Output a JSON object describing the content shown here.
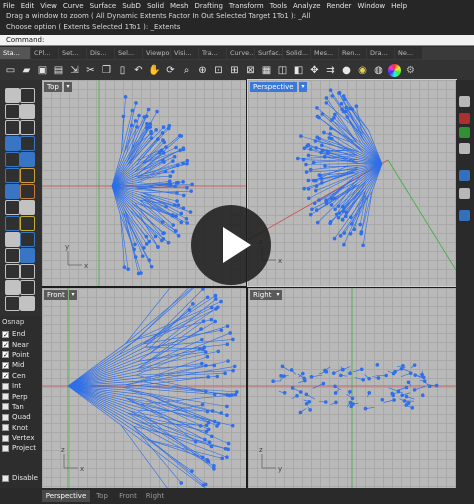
{
  "menu": [
    "File",
    "Edit",
    "View",
    "Curve",
    "Surface",
    "SubD",
    "Solid",
    "Mesh",
    "Drafting",
    "Transform",
    "Tools",
    "Analyze",
    "Render",
    "Window",
    "Help"
  ],
  "history": [
    "Drag a window to zoom ( All  Dynamic  Extents  Factor  In  Out  Selected  Target  1To1 ): _All",
    "Choose option ( Extents  Selected  1To1 ): _Extents"
  ],
  "command_prompt": "Command:",
  "toolbar_tabs": [
    "Sta...",
    "CPl...",
    "Set...",
    "Dis...",
    "Sel...",
    "Viewpo...",
    "Visi...",
    "Tra...",
    "Curve...",
    "Surfac...",
    "Solid...",
    "Mes...",
    "Ren...",
    "Dra...",
    "Ne..."
  ],
  "toolbar_icons": [
    "new-file-icon",
    "open-folder-icon",
    "save-icon",
    "print-icon",
    "import-icon",
    "cut-icon",
    "copy-icon",
    "paste-icon",
    "undo-icon",
    "pan-hand-icon",
    "rotate-view-icon",
    "zoom-icon",
    "zoom-window-icon",
    "zoom-extents-icon",
    "zoom-selected-icon",
    "zoom-all-icon",
    "four-views-icon",
    "set-cplane-icon",
    "cplane-icon",
    "move-icon",
    "copy-move-icon",
    "shade-icon",
    "render-icon",
    "materials-icon",
    "color-wheel-icon",
    "options-icon"
  ],
  "viewports": [
    {
      "label": "Top",
      "active": false
    },
    {
      "label": "Perspective",
      "active": true
    },
    {
      "label": "Front",
      "active": false
    },
    {
      "label": "Right",
      "active": false
    }
  ],
  "osnap": {
    "title": "Osnap",
    "items": [
      {
        "label": "End",
        "checked": true
      },
      {
        "label": "Near",
        "checked": true
      },
      {
        "label": "Point",
        "checked": true
      },
      {
        "label": "Mid",
        "checked": true
      },
      {
        "label": "Cen",
        "checked": true
      },
      {
        "label": "Int",
        "checked": false
      },
      {
        "label": "Perp",
        "checked": false
      },
      {
        "label": "Tan",
        "checked": false
      },
      {
        "label": "Quad",
        "checked": false
      },
      {
        "label": "Knot",
        "checked": false
      },
      {
        "label": "Vertex",
        "checked": false
      },
      {
        "label": "Project",
        "checked": false
      }
    ],
    "disable": "Disable"
  },
  "bottom_tabs": [
    "Perspective",
    "Top",
    "Front",
    "Right"
  ],
  "axis_labels": {
    "x": "x",
    "y": "y",
    "z": "z"
  },
  "colors": {
    "curve_blue": "#2f6fe8",
    "axis_red": "#c84a4a",
    "axis_green": "#3fae3f",
    "viewport_bg": "#b9b9b9",
    "active_label": "#3a78d9"
  },
  "play_button": "play-icon"
}
